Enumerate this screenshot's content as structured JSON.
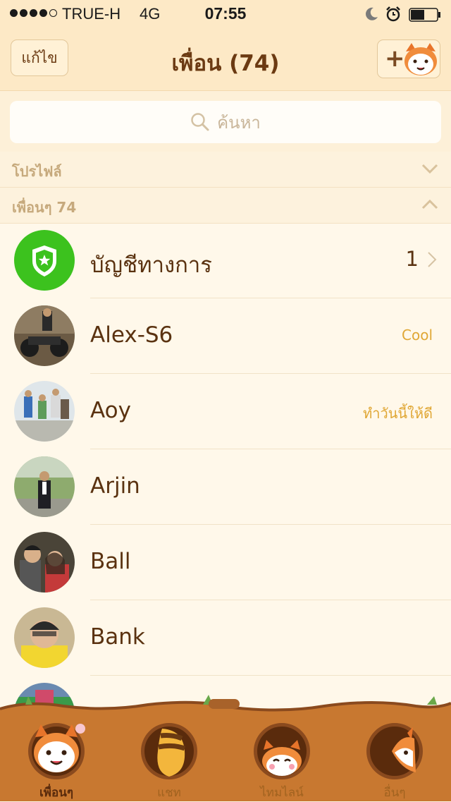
{
  "status_bar": {
    "carrier": "TRUE-H",
    "network": "4G",
    "time": "07:55"
  },
  "nav": {
    "edit_label": "แก้ไข",
    "title": "เพื่อน (74)"
  },
  "search": {
    "placeholder": "ค้นหา"
  },
  "sections": {
    "profile_label": "โปรไฟล์",
    "friends_label": "เพื่อนๆ 74"
  },
  "official": {
    "name": "บัญชีทางการ",
    "count": "1"
  },
  "friends": [
    {
      "name": "Alex-S6",
      "status": "Cool"
    },
    {
      "name": "Aoy",
      "status": "ทำวันนี้ให้ดี"
    },
    {
      "name": "Arjin",
      "status": ""
    },
    {
      "name": "Ball",
      "status": ""
    },
    {
      "name": "Bank",
      "status": ""
    }
  ],
  "tabs": [
    {
      "label": "เพื่อนๆ"
    },
    {
      "label": "แชท"
    },
    {
      "label": "ไทมไลน์"
    },
    {
      "label": "อื่นๆ"
    }
  ],
  "colors": {
    "accent": "#e0a735",
    "official_green": "#3cc21e",
    "text_brown": "#5a3210",
    "header_bg": "#fde9c6",
    "tab_bar_bg": "#c87830"
  },
  "icons": {
    "search": "search-icon",
    "official": "shield-star-icon",
    "add_friend": "add-friend-icon"
  }
}
